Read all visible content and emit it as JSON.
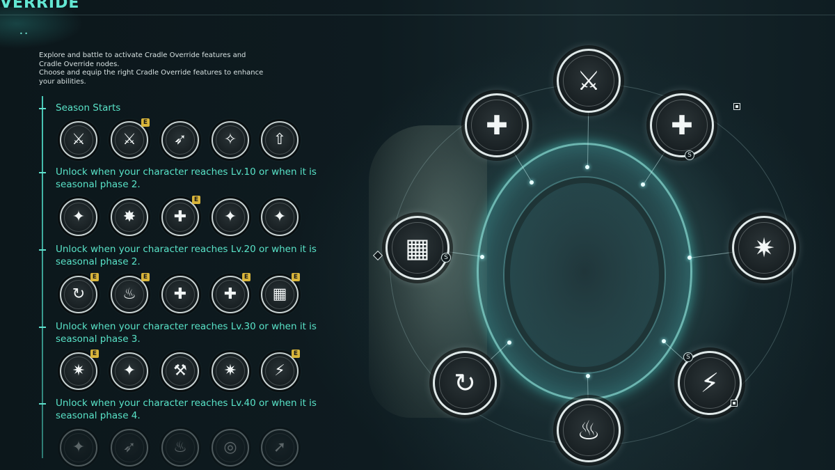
{
  "header": {
    "title": "VERRIDE"
  },
  "description": {
    "line1": "Explore and battle to activate Cradle Override features and Cradle Override nodes.",
    "line2": "Choose and equip the right Cradle Override features to enhance your abilities."
  },
  "tiers": [
    {
      "label": "Season Starts",
      "nodes": [
        {
          "icon": "rifle-ammo-icon",
          "glyph": "⚔",
          "badge": ""
        },
        {
          "icon": "rifle-ammo-green-icon",
          "glyph": "⚔",
          "badge": "E"
        },
        {
          "icon": "launcher-ammo-icon",
          "glyph": "➶",
          "badge": ""
        },
        {
          "icon": "sniper-fire-icon",
          "glyph": "✧",
          "badge": ""
        },
        {
          "icon": "rifle-upgrade-icon",
          "glyph": "⇧",
          "badge": ""
        }
      ]
    },
    {
      "label": "Unlock when your character reaches Lv.10 or when it is seasonal phase 2.",
      "nodes": [
        {
          "icon": "grenade-icon",
          "glyph": "✦",
          "badge": ""
        },
        {
          "icon": "shatter-icon",
          "glyph": "✸",
          "badge": ""
        },
        {
          "icon": "canister-heal-icon",
          "glyph": "✚",
          "badge": "E"
        },
        {
          "icon": "rifle-burst-icon",
          "glyph": "✦",
          "badge": ""
        },
        {
          "icon": "pistol-burst-icon",
          "glyph": "✦",
          "badge": ""
        }
      ]
    },
    {
      "label": "Unlock when your character reaches Lv.20 or when it is seasonal phase 2.",
      "nodes": [
        {
          "icon": "reload-cycle-icon",
          "glyph": "↻",
          "badge": "E"
        },
        {
          "icon": "flame-boost-icon",
          "glyph": "♨",
          "badge": "E"
        },
        {
          "icon": "knife-heal-icon",
          "glyph": "✚",
          "badge": ""
        },
        {
          "icon": "canister-heal-icon",
          "glyph": "✚",
          "badge": "E"
        },
        {
          "icon": "armor-plate-icon",
          "glyph": "▦",
          "badge": "E"
        }
      ]
    },
    {
      "label": "Unlock when your character reaches Lv.30 or when it is seasonal phase 3.",
      "nodes": [
        {
          "icon": "burst-shard-icon",
          "glyph": "✷",
          "badge": "E"
        },
        {
          "icon": "blade-strike-icon",
          "glyph": "✦",
          "badge": ""
        },
        {
          "icon": "hammer-strike-icon",
          "glyph": "⚒",
          "badge": ""
        },
        {
          "icon": "explosion-icon",
          "glyph": "✷",
          "badge": ""
        },
        {
          "icon": "shock-burst-icon",
          "glyph": "⚡",
          "badge": "E"
        }
      ]
    },
    {
      "label": "Unlock when your character reaches Lv.40 or when it is seasonal phase 4.",
      "nodes": [
        {
          "icon": "claw-icon",
          "glyph": "✦",
          "badge": ""
        },
        {
          "icon": "dash-icon",
          "glyph": "➶",
          "badge": ""
        },
        {
          "icon": "flame-icon",
          "glyph": "♨",
          "badge": ""
        },
        {
          "icon": "target-icon",
          "glyph": "◎",
          "badge": ""
        },
        {
          "icon": "arrow-icon",
          "glyph": "➚",
          "badge": ""
        }
      ]
    }
  ],
  "ring_nodes": [
    {
      "icon": "rifle-ammo-icon",
      "glyph": "⚔"
    },
    {
      "icon": "canister-heal-icon",
      "glyph": "✚"
    },
    {
      "icon": "canister-heal-icon",
      "glyph": "✚"
    },
    {
      "icon": "armor-plate-icon",
      "glyph": "▦"
    },
    {
      "icon": "explosion-icon",
      "glyph": "✷"
    },
    {
      "icon": "reload-cycle-icon",
      "glyph": "↻"
    },
    {
      "icon": "shock-burst-icon",
      "glyph": "⚡"
    },
    {
      "icon": "flame-boost-icon",
      "glyph": "♨"
    }
  ],
  "marks": {
    "s": "S"
  }
}
